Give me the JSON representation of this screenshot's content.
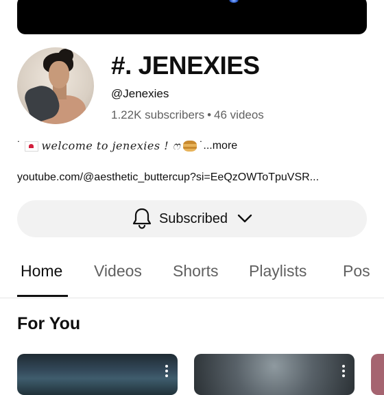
{
  "channel": {
    "name": "#. JENEXIES",
    "handle": "@Jenexies",
    "subscribers": "1.22K subscribers",
    "separator": "•",
    "videos": "46 videos",
    "description_prefix": "˙",
    "description_text": "welcome to jenexies ! ෆ",
    "description_suffix": "˙",
    "description_more": "...more",
    "link": "youtube.com/@aesthetic_buttercup?si=EeQzOWToTpuVSR..."
  },
  "subscribe_button": {
    "label": "Subscribed"
  },
  "tabs": [
    {
      "label": "Home",
      "active": true
    },
    {
      "label": "Videos",
      "active": false
    },
    {
      "label": "Shorts",
      "active": false
    },
    {
      "label": "Playlists",
      "active": false
    },
    {
      "label": "Pos",
      "active": false
    }
  ],
  "section": {
    "title": "For You"
  },
  "icons": [
    "bell-icon",
    "chevron-down-icon",
    "more-vert-icon",
    "envelope-heart-icon",
    "pancake-icon"
  ],
  "colors": {
    "text": "#0f0f0f",
    "secondary_text": "#606060",
    "button_bg": "#f2f2f2"
  }
}
